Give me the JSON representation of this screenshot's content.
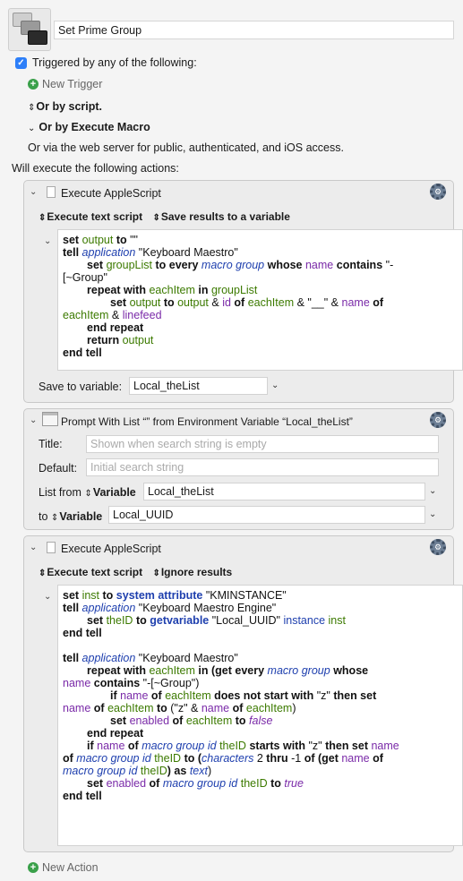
{
  "macro": {
    "name": "Set Prime Group"
  },
  "trigger": {
    "label": "Triggered by any of the following:",
    "new_trigger": "New Trigger",
    "or_by_script": "Or by script.",
    "or_by_execute_macro": "Or by Execute Macro",
    "web_server": "Or via the web server for public, authenticated, and iOS access."
  },
  "will_execute": "Will execute the following actions:",
  "action1": {
    "title": "Execute AppleScript",
    "opt1": "Execute text script",
    "opt2": "Save results to a variable",
    "save_label": "Save to variable:",
    "save_value": "Local_theList",
    "code": [
      [
        "set",
        "output",
        "to",
        "\"\""
      ],
      [
        "tell",
        "application",
        "\"Keyboard Maestro\""
      ],
      [
        "set",
        "groupList",
        "to every",
        "macro group",
        "whose",
        "name",
        "contains",
        "\"-"
      ],
      [
        "[~Group\""
      ],
      [
        "repeat with",
        "eachItem",
        "in",
        "groupList"
      ],
      [
        "set",
        "output",
        "to",
        "output",
        "&",
        "id",
        "of",
        "eachItem",
        "& \"__\" &",
        "name",
        "of"
      ],
      [
        "eachItem",
        "&",
        "linefeed"
      ],
      [
        "end repeat"
      ],
      [
        "return",
        "output"
      ],
      [
        "end tell"
      ]
    ]
  },
  "action2": {
    "title": "Prompt With List “” from Environment Variable “Local_theList”",
    "title_label": "Title:",
    "title_placeholder": "Shown when search string is empty",
    "default_label": "Default:",
    "default_placeholder": "Initial search string",
    "listfrom_label": "List from",
    "variable_label": "Variable",
    "listfrom_value": "Local_theList",
    "to_label": "to",
    "to_value": "Local_UUID"
  },
  "action3": {
    "title": "Execute AppleScript",
    "opt1": "Execute text script",
    "opt2": "Ignore results",
    "code": [
      [
        "set",
        "inst",
        "to",
        "system attribute",
        "\"KMINSTANCE\""
      ],
      [
        "tell",
        "application",
        "\"Keyboard Maestro Engine\""
      ],
      [
        "set",
        "theID",
        "to",
        "getvariable",
        "\"Local_UUID\"",
        "instance",
        "inst"
      ],
      [
        "end tell"
      ],
      [
        "tell",
        "application",
        "\"Keyboard Maestro\""
      ],
      [
        "repeat with",
        "eachItem",
        "in (",
        "get every",
        "macro group",
        "whose"
      ],
      [
        "name",
        "contains",
        "\"-[~Group\")"
      ],
      [
        "if",
        "name",
        "of",
        "eachItem",
        "does not start with",
        "\"z\"",
        "then set"
      ],
      [
        "name",
        "of",
        "eachItem",
        "to",
        "(\"z\" &",
        "name",
        "of",
        "eachItem",
        ")"
      ],
      [
        "set",
        "enabled",
        "of",
        "eachItem",
        "to",
        "false"
      ],
      [
        "end repeat"
      ],
      [
        "if",
        "name",
        "of",
        "macro group",
        "id",
        "theID",
        "starts with",
        "\"z\"",
        "then set",
        "name"
      ],
      [
        "of",
        "macro group",
        "id",
        "theID",
        "to (",
        "characters",
        "2",
        "thru",
        "-1",
        "of (",
        "get",
        "name",
        "of"
      ],
      [
        "macro group",
        "id",
        "theID",
        ") as",
        "text",
        ")"
      ],
      [
        "set",
        "enabled",
        "of",
        "macro group",
        "id",
        "theID",
        "to",
        "true"
      ],
      [
        "end tell"
      ]
    ]
  },
  "new_action": "New Action",
  "colors": {
    "accent": "#2d7ff9",
    "plus": "#3aa04a",
    "variable": "#3c7a00",
    "app": "#1e3fae",
    "property": "#7a2aa8"
  }
}
